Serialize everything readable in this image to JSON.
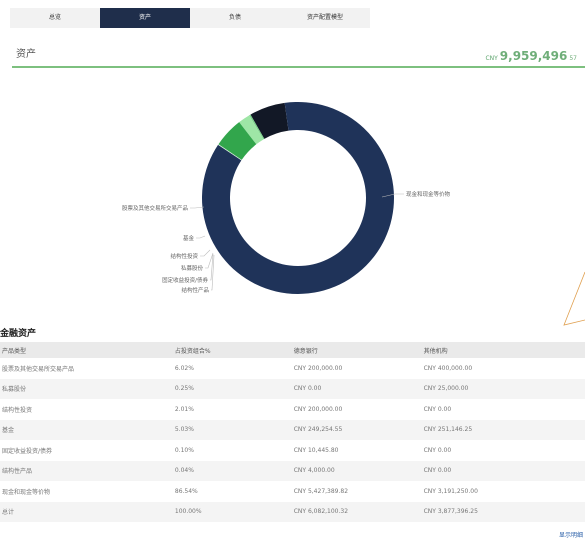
{
  "tabs": [
    "总览",
    "资产",
    "负债",
    "资产配置模型"
  ],
  "active_tab": 1,
  "section_title": "资产",
  "total": {
    "currency": "CNY",
    "amount": "9,959,496",
    "decimals": "57"
  },
  "chart_data": {
    "type": "pie",
    "categories": [
      "股票及其他交易所交易产品",
      "私募股份",
      "结构性投资",
      "基金",
      "固定收益投资/债券",
      "结构性产品",
      "现金和现金等价物"
    ],
    "values": [
      6.02,
      0.25,
      2.01,
      5.03,
      0.1,
      0.04,
      86.54
    ],
    "colors": [
      "#121826",
      "#7bd08a",
      "#9ee6a6",
      "#32a64c",
      "#ccefd2",
      "#e6f7e9",
      "#1f3359"
    ],
    "labels": {
      "cash": "现金和现金等价物",
      "stocks": "股票及其他交易所交易产品",
      "fund": "基金",
      "structured_inv": "结构性投资",
      "private_equity": "私募股份",
      "fixed_income": "固定收益投资/债券",
      "structured_prod": "结构性产品"
    }
  },
  "table": {
    "title": "金融资产",
    "headers": [
      "产品类型",
      "占投资组合%",
      "德意银行",
      "其他机构"
    ],
    "rows": [
      [
        "股票及其他交易所交易产品",
        "6.02%",
        "CNY 200,000.00",
        "CNY 400,000.00"
      ],
      [
        "私募股份",
        "0.25%",
        "CNY 0.00",
        "CNY 25,000.00"
      ],
      [
        "结构性投资",
        "2.01%",
        "CNY 200,000.00",
        "CNY 0.00"
      ],
      [
        "基金",
        "5.03%",
        "CNY 249,254.55",
        "CNY 251,146.25"
      ],
      [
        "固定收益投资/债券",
        "0.10%",
        "CNY 10,445.80",
        "CNY 0.00"
      ],
      [
        "结构性产品",
        "0.04%",
        "CNY 4,000.00",
        "CNY 0.00"
      ],
      [
        "现金和现金等价物",
        "86.54%",
        "CNY 5,427,389.82",
        "CNY 3,191,250.00"
      ],
      [
        "总计",
        "100.00%",
        "CNY 6,082,100.32",
        "CNY 3,877,396.25"
      ]
    ]
  },
  "footer_link": "显示明细"
}
